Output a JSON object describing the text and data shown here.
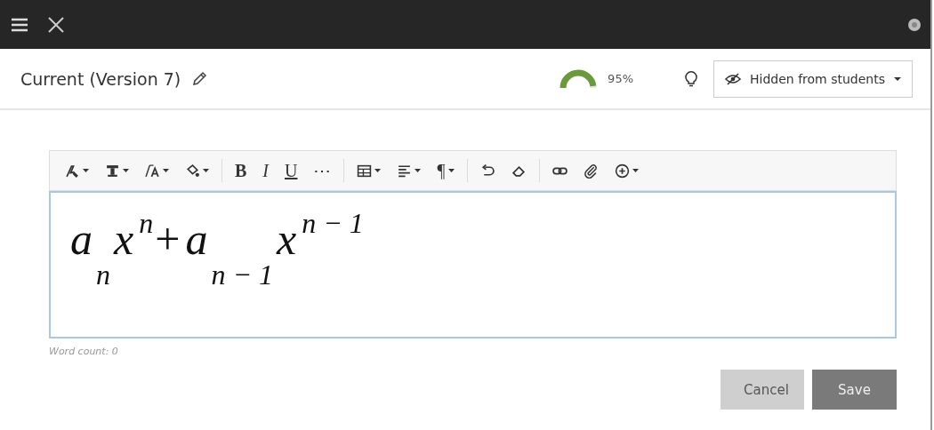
{
  "header": {
    "title": "Current (Version 7)",
    "score": {
      "reading": "95%"
    },
    "visibility": {
      "label": "Hidden from students"
    }
  },
  "toolbar": [
    {
      "kind": "pen",
      "dropdown": true
    },
    {
      "kind": "style",
      "dropdown": true
    },
    {
      "kind": "fontsize",
      "dropdown": true
    },
    {
      "kind": "fill",
      "dropdown": true
    },
    {
      "kind": "separator"
    },
    {
      "kind": "bold",
      "label": "B"
    },
    {
      "kind": "italic",
      "label": "I"
    },
    {
      "kind": "underline",
      "label": "U"
    },
    {
      "kind": "more",
      "label": "⋯"
    },
    {
      "kind": "separator"
    },
    {
      "kind": "table",
      "dropdown": true
    },
    {
      "kind": "align",
      "dropdown": true
    },
    {
      "kind": "paragraph",
      "label": "¶",
      "dropdown": true
    },
    {
      "kind": "separator"
    },
    {
      "kind": "undo"
    },
    {
      "kind": "eraser"
    },
    {
      "kind": "separator"
    },
    {
      "kind": "link"
    },
    {
      "kind": "clip"
    },
    {
      "kind": "plus",
      "dropdown": true
    }
  ],
  "equation": [
    {
      "kind": "base",
      "text": "a"
    },
    {
      "kind": "sub",
      "text": "n"
    },
    {
      "kind": "base",
      "text": "x"
    },
    {
      "kind": "sup",
      "text": "n"
    },
    {
      "kind": "op",
      "text": "+"
    },
    {
      "kind": "base",
      "text": "a"
    },
    {
      "kind": "sub",
      "text": "n − 1"
    },
    {
      "kind": "base",
      "text": "x"
    },
    {
      "kind": "sup",
      "text": "n − 1"
    }
  ],
  "word_count": "Word count: 0",
  "buttons": [
    {
      "label": "Cancel",
      "kind": "secondary"
    },
    {
      "label": "Save",
      "kind": "primary"
    }
  ]
}
